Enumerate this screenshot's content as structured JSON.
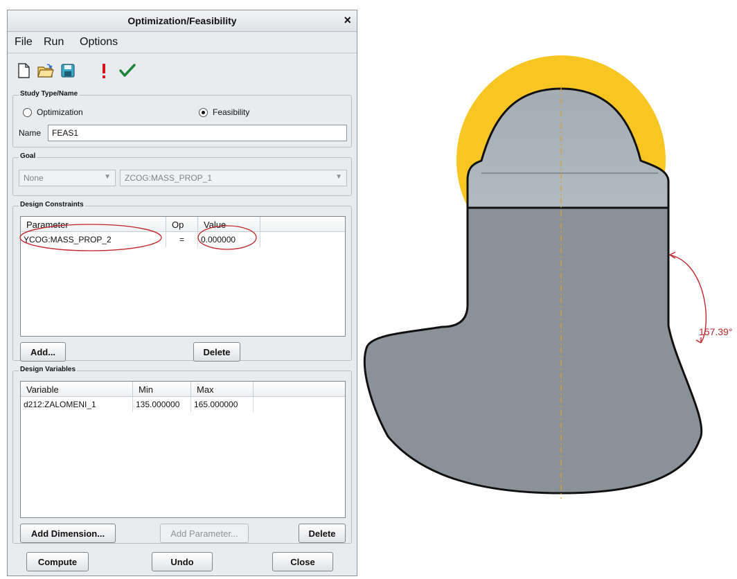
{
  "dialog": {
    "title": "Optimization/Feasibility",
    "close_glyph": "×",
    "menu": [
      "File",
      "Run",
      "Options"
    ],
    "toolbar_icons": [
      "new-file-icon",
      "open-folder-icon",
      "save-icon",
      "exclamation-icon",
      "checkmark-icon"
    ],
    "study": {
      "legend": "Study Type/Name",
      "option_optimization": "Optimization",
      "option_feasibility": "Feasibility",
      "selected": "Feasibility",
      "name_label": "Name",
      "name_value": "FEAS1"
    },
    "goal": {
      "legend": "Goal",
      "type_value": "None",
      "param_value": "ZCOG:MASS_PROP_1"
    },
    "constraints": {
      "legend": "Design Constraints",
      "columns": [
        "Parameter",
        "Op",
        "Value"
      ],
      "rows": [
        [
          "YCOG:MASS_PROP_2",
          "=",
          "0.000000"
        ]
      ],
      "add_label": "Add...",
      "delete_label": "Delete"
    },
    "variables": {
      "legend": "Design Variables",
      "columns": [
        "Variable",
        "Min",
        "Max"
      ],
      "rows": [
        [
          "d212:ZALOMENI_1",
          "135.000000",
          "165.000000"
        ]
      ],
      "add_dimension_label": "Add Dimension...",
      "add_parameter_label": "Add Parameter...",
      "delete_label": "Delete"
    },
    "footer": {
      "compute_label": "Compute",
      "undo_label": "Undo",
      "close_label": "Close"
    }
  },
  "model": {
    "angle_label": "157.39°",
    "colors": {
      "body": "#8a9199",
      "body_top": "#a5adb6",
      "halo": "#f8c623",
      "centerline": "#e0a020",
      "dimension": "#c0232b",
      "annotation": "#c0232b"
    }
  }
}
